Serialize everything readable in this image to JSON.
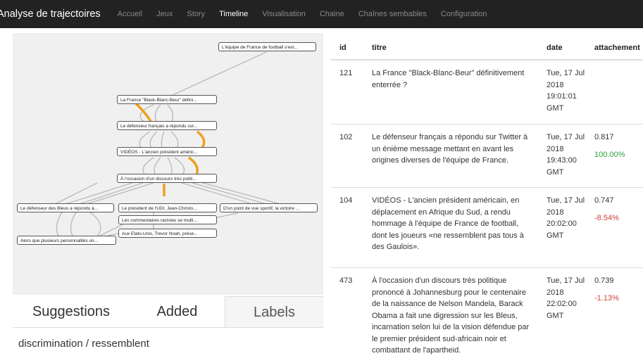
{
  "nav": {
    "brand": "Analyse de trajectoires",
    "items": [
      {
        "label": "Accueil",
        "active": false
      },
      {
        "label": "Jeux",
        "active": false
      },
      {
        "label": "Story",
        "active": false
      },
      {
        "label": "Timeline",
        "active": true
      },
      {
        "label": "Visualisation",
        "active": false
      },
      {
        "label": "Chaine",
        "active": false
      },
      {
        "label": "Chaînes sembables",
        "active": false
      },
      {
        "label": "Configuration",
        "active": false
      }
    ]
  },
  "graph": {
    "nodes": [
      "L'équipe de France de football s'est...",
      "La France \"Black-Blanc-Beur\" défini...",
      "Le défenseur français a répondu sur...",
      "VIDÉOS - L'ancien président améric...",
      "À l'occasion d'un discours très politi...",
      "Le défenseur des Bleus a répondu à...",
      "Le président de l'UDI, Jean-Christo...",
      "D'un point de vue sportif, la victoire ...",
      "Les commentaires racistes se multi...",
      "Aux Etats-Unis, Trevor Noah, prése...",
      "Alors que plusieurs personnalités on..."
    ],
    "edge_color": "#bbbbbb",
    "highlight_color": "#f0a020"
  },
  "tabs": {
    "suggestions": "Suggestions",
    "added": "Added",
    "labels": "Labels"
  },
  "query": "discrimination / ressemblent",
  "table": {
    "columns": [
      "id",
      "titre",
      "date",
      "attachement"
    ],
    "rows": [
      {
        "id": "121",
        "title": "La France \"Black-Blanc-Beur\" définitivement enterrée ?",
        "date": "Tue, 17 Jul 2018 19:01:01 GMT",
        "score": "",
        "pct": ""
      },
      {
        "id": "102",
        "title": "Le défenseur français a répondu sur Twitter à un énième message mettant en avant les origines diverses de l'équipe de France.",
        "date": "Tue, 17 Jul 2018 19:43:00 GMT",
        "score": "0.817",
        "pct": "100.00%"
      },
      {
        "id": "104",
        "title": "VIDÉOS - L'ancien président américain, en déplacement en Afrique du Sud, a rendu hommage à l'équipe de France de football, dont les joueurs «ne ressemblent pas tous à des Gaulois».",
        "date": "Tue, 17 Jul 2018 20:02:00 GMT",
        "score": "0.747",
        "pct": "-8.54%"
      },
      {
        "id": "473",
        "title": "À l'occasion d'un discours très politique prononcé à Johannesburg pour le centenaire de la naissance de Nelson Mandela, Barack Obama a fait une digression sur les Bleus, incarnation selon lui de la vision défendue par le premier président sud-africain noir et combattant de l'apartheid.",
        "date": "Tue, 17 Jul 2018 22:02:00 GMT",
        "score": "0.739",
        "pct": "-1.13%"
      }
    ]
  }
}
